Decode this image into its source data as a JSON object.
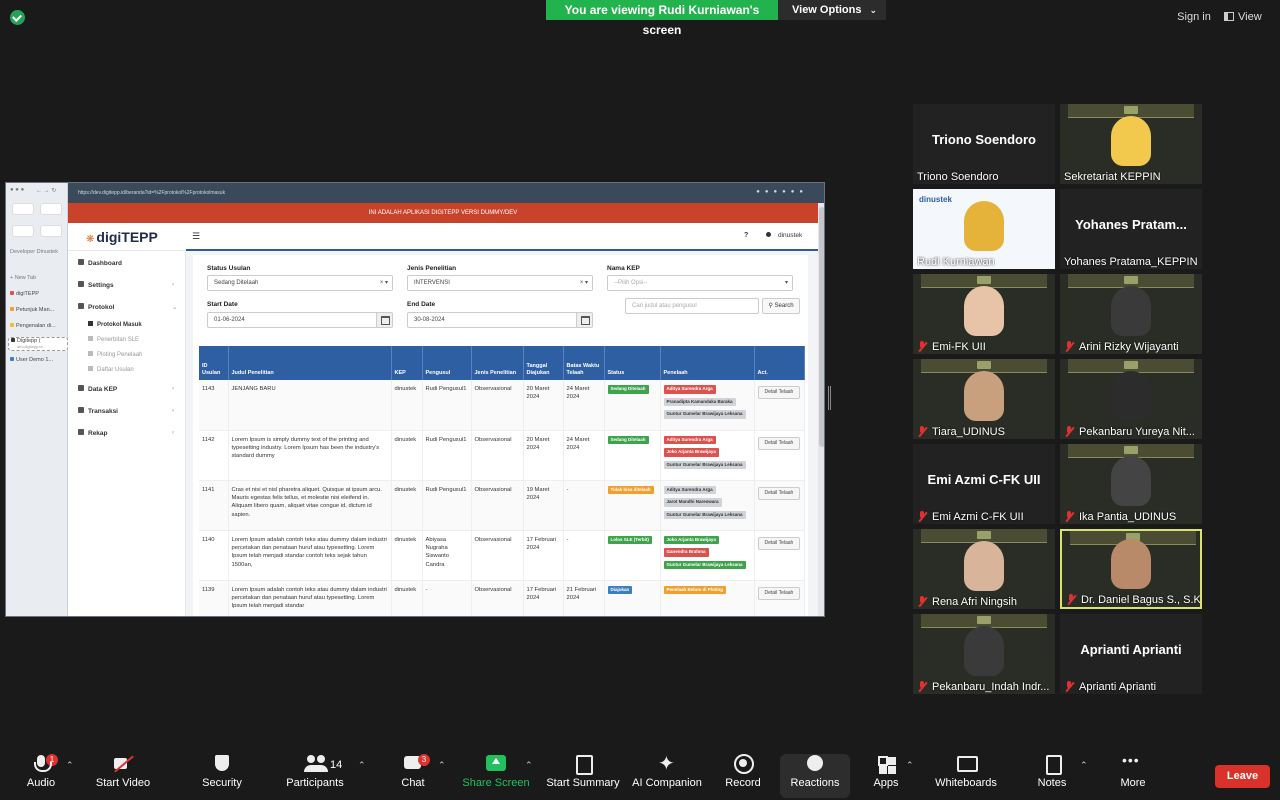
{
  "zoom": {
    "banner": "You are viewing Rudi Kurniawan's screen",
    "view_options": "View Options",
    "sign_in": "Sign in",
    "view": "View"
  },
  "browser": {
    "url": "https://dev.digitepp.id/beranda?id=%2Fprotokol%2Fprotokolmasuk",
    "sidebar": {
      "group": "Developer Dinustek",
      "new_tab": "New Tab",
      "tabs": [
        "digiTEPP",
        "Petunjuk Man...",
        "Pengenalan di...",
        "Digitepp (",
        "User Demo 1..."
      ],
      "active_sub": "dev.digitepp.id"
    }
  },
  "app": {
    "dev_banner": "INI ADALAH APLIKASI DIGITEPP VERSI DUMMY/DEV",
    "brand": "digiTEPP",
    "help": "?",
    "user": "dinustek",
    "menu": {
      "dashboard": "Dashboard",
      "settings": "Settings",
      "protokol": "Protokol",
      "sub": [
        "Protokol Masuk",
        "Penerbitan SLE",
        "Ploting Penelaah",
        "Daftar Usulan"
      ],
      "data_kep": "Data KEP",
      "transaksi": "Transaksi",
      "rekap": "Rekap"
    },
    "filters": {
      "status_label": "Status Usulan",
      "status_value": "Sedang Ditelaah",
      "jenis_label": "Jenis Penelitian",
      "jenis_value": "INTERVENSI",
      "kep_label": "Nama KEP",
      "kep_placeholder": "--Pilih Opsi--",
      "start_label": "Start Date",
      "start_value": "01-06-2024",
      "end_label": "End Date",
      "end_value": "30-08-2024",
      "search_placeholder": "Cari judul atau pengusul",
      "search_button": "Search"
    },
    "table": {
      "headers": [
        "ID Usulan",
        "Judul Penelitian",
        "KEP",
        "Pengusul",
        "Jenis Penelitian",
        "Tanggal Diajukan",
        "Batas Waktu Telaah",
        "Status",
        "Penelaah",
        "Act."
      ],
      "action_label": "Detail Telaah",
      "rows": [
        {
          "id": "1143",
          "judul": "JENJANG BARU",
          "kep": "dinustek",
          "pengusul": "Rudi Pengusul1",
          "jenis": "Observasional",
          "tanggal": "20 Maret 2024",
          "batas": "24 Maret 2024",
          "status": "Sedang Ditelaah",
          "status_color": "#3fa34d",
          "penelaah": [
            {
              "n": "Aditya Surendra Arga",
              "c": "#d9534f"
            },
            {
              "n": "Pranadipta Kamandaka Baraka",
              "c": "#d0d3d7"
            },
            {
              "n": "Guntur Gumelar Brawijaya Leksana",
              "c": "#d0d3d7"
            }
          ]
        },
        {
          "id": "1142",
          "judul": "Lorem Ipsum is simply dummy text of the printing and typesetting industry. Lorem Ipsum has been the industry's standard dummy",
          "kep": "dinustek",
          "pengusul": "Rudi Pengusul1",
          "jenis": "Observasional",
          "tanggal": "20 Maret 2024",
          "batas": "24 Maret 2024",
          "status": "Sedang Ditelaah",
          "status_color": "#3fa34d",
          "penelaah": [
            {
              "n": "Aditya Surendra Arga",
              "c": "#d9534f"
            },
            {
              "n": "Joko Arjanta Brawijaya",
              "c": "#d9534f"
            },
            {
              "n": "Guntur Gumelar Brawijaya Leksana",
              "c": "#d0d3d7"
            }
          ]
        },
        {
          "id": "1141",
          "judul": "Cras et nisi et nisl pharetra aliquet. Quisque at ipsum arcu. Mauris egestas felis tellus, et molestie nisi eleifend in. Aliquam libero quam, aliquet vitae congue id, dictum id sapien.",
          "kep": "dinustek",
          "pengusul": "Rudi Pengusul1",
          "jenis": "Observasional",
          "tanggal": "19 Maret 2024",
          "batas": "-",
          "status": "Tidak bisa ditelaah",
          "status_color": "#f0a030",
          "penelaah": [
            {
              "n": "Aditya Surendra Arga",
              "c": "#d0d3d7"
            },
            {
              "n": "Jarot Mandhi Nareswara",
              "c": "#d0d3d7"
            },
            {
              "n": "Guntur Gumelar Brawijaya Leksana",
              "c": "#d0d3d7"
            }
          ]
        },
        {
          "id": "1140",
          "judul": "Lorem Ipsum adalah contoh teks atau dummy dalam industri percetakan dan penataan huruf atau typesetting. Lorem Ipsum telah menjadi standar contoh teks sejak tahun 1500an,",
          "kep": "dinustek",
          "pengusul": "Abiyasa Nugraha Siswanto Candra",
          "jenis": "Observasional",
          "tanggal": "17 Februari 2024",
          "batas": "-",
          "status": "Lolos SLE (Terbit)",
          "status_color": "#3fa34d",
          "penelaah": [
            {
              "n": "Joko Arjanta Brawijaya",
              "c": "#3fa34d"
            },
            {
              "n": "Ganendra Brahma",
              "c": "#d9534f"
            },
            {
              "n": "Guntur Gumelar Brawijaya Leksana",
              "c": "#3fa34d"
            }
          ]
        },
        {
          "id": "1139",
          "judul": "Lorem Ipsum adalah contoh teks atau dummy dalam industri percetakan dan penataan huruf atau typesetting. Lorem Ipsum telah menjadi standar",
          "kep": "dinustek",
          "pengusul": "-",
          "jenis": "Observasional",
          "tanggal": "17 Februari 2024",
          "batas": "21 Februari 2024",
          "status": "Diajukan",
          "status_color": "#3c7fc0",
          "penelaah": [
            {
              "n": "Penelaah Belum di Ploting",
              "c": "#f0a030"
            }
          ]
        }
      ]
    }
  },
  "participants": [
    {
      "name": "Triono Soendoro",
      "label": "Triono Soendoro",
      "video": false,
      "muted": false
    },
    {
      "name": "",
      "label": "Sekretariat KEPPIN",
      "video": true,
      "muted": false,
      "skin": "#f2c94c"
    },
    {
      "name": "",
      "label": "Rudi Kurniawan",
      "video": true,
      "muted": false,
      "brand": "dinustek"
    },
    {
      "name": "Yohanes Pratam...",
      "label": "Yohanes Pratama_KEPPIN",
      "video": false,
      "muted": false
    },
    {
      "name": "",
      "label": "Emi-FK UII",
      "video": true,
      "muted": true,
      "skin": "#e7c3a8"
    },
    {
      "name": "",
      "label": "Arini Rizky Wijayanti",
      "video": true,
      "muted": true,
      "skin": "#3a3a3a"
    },
    {
      "name": "",
      "label": "Tiara_UDINUS",
      "video": true,
      "muted": true,
      "skin": "#c9a07e"
    },
    {
      "name": "",
      "label": "Pekanbaru Yureya Nit...",
      "video": true,
      "muted": true,
      "skin": "#2c2c2c"
    },
    {
      "name": "Emi Azmi C-FK UII",
      "label": "Emi Azmi C-FK UII",
      "video": false,
      "muted": true
    },
    {
      "name": "",
      "label": "Ika Pantia_UDINUS",
      "video": true,
      "muted": true,
      "skin": "#444"
    },
    {
      "name": "",
      "label": "Rena Afri Ningsih",
      "video": true,
      "muted": true,
      "skin": "#d8b59a"
    },
    {
      "name": "",
      "label": "Dr. Daniel Bagus S., S.Ke...",
      "video": true,
      "muted": true,
      "skin": "#b98a6a",
      "speaking": true
    },
    {
      "name": "",
      "label": "Pekanbaru_Indah Indr...",
      "video": true,
      "muted": true,
      "skin": "#3a3a3a"
    },
    {
      "name": "Aprianti Aprianti",
      "label": "Aprianti Aprianti",
      "video": false,
      "muted": true
    }
  ],
  "toolbar": {
    "audio": "Audio",
    "audio_badge": "1",
    "video": "Start Video",
    "security": "Security",
    "participants": "Participants",
    "participants_count": "14",
    "chat": "Chat",
    "chat_badge": "3",
    "share": "Share Screen",
    "summary": "Start Summary",
    "ai": "AI Companion",
    "record": "Record",
    "reactions": "Reactions",
    "apps": "Apps",
    "whiteboards": "Whiteboards",
    "notes": "Notes",
    "more": "More",
    "leave": "Leave"
  }
}
